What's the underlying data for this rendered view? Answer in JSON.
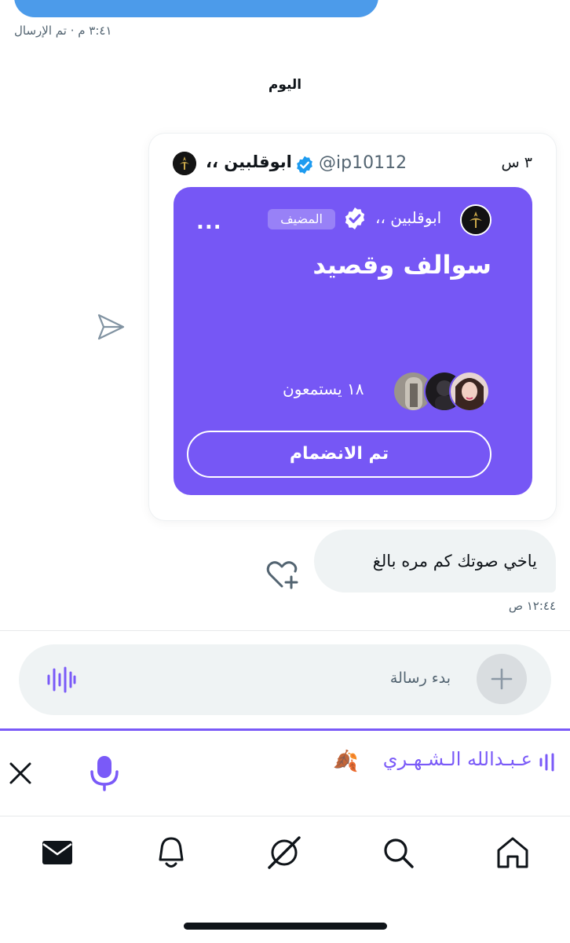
{
  "chat": {
    "previous_status": "٣:٤١ م · تم الإرسال",
    "day_separator": "اليوم"
  },
  "shared_post": {
    "time_ago": "٣ س",
    "author_name": "ابوقلبين ،،",
    "author_handle": "@ip10112",
    "space": {
      "host_name": "ابوقلبين ،،",
      "host_badge": "المضيف",
      "more": "...",
      "title": "سوالف وقصيد",
      "listeners": "١٨ يستمعون",
      "join_button": "تم الانضمام",
      "accent_color": "#7657f5"
    }
  },
  "message": {
    "text": "ياخي صوتك كم مره بالغ",
    "time": "١٢:٤٤ ص"
  },
  "composer": {
    "placeholder": "بدء رسالة"
  },
  "space_dock": {
    "title": "عـبـدالله الـشـهـري",
    "emoji": "🍂",
    "accent_color": "#7a5af8"
  },
  "bottom_nav": {
    "items": [
      "messages-icon",
      "notifications-icon",
      "spaces-icon",
      "search-icon",
      "home-icon"
    ]
  }
}
